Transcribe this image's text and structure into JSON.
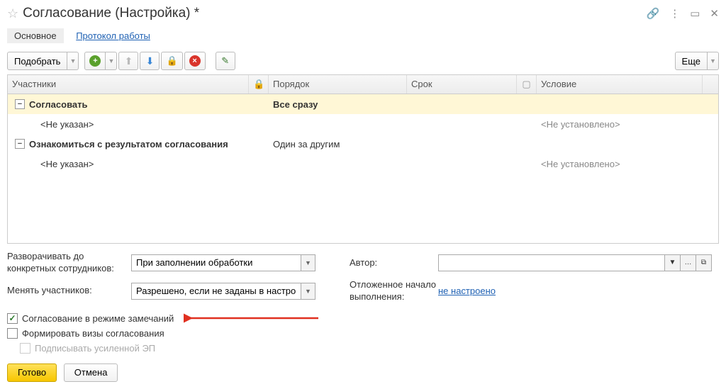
{
  "titlebar": {
    "title": "Согласование (Настройка) *"
  },
  "tabs": {
    "main": "Основное",
    "protocol": "Протокол работы"
  },
  "toolbar": {
    "pick_label": "Подобрать",
    "more_label": "Еще"
  },
  "table": {
    "headers": {
      "participants": "Участники",
      "order": "Порядок",
      "term": "Срок",
      "cond": "Условие"
    },
    "rows": [
      {
        "type": "group",
        "label": "Согласовать",
        "order": "Все сразу"
      },
      {
        "type": "child",
        "label": "<Не указан>",
        "cond": "<Не установлено>"
      },
      {
        "type": "group2",
        "label": "Ознакомиться с результатом согласования",
        "order": "Один за другим"
      },
      {
        "type": "child",
        "label": "<Не указан>",
        "cond": "<Не установлено>"
      }
    ]
  },
  "form": {
    "expand_to_label": "Разворачивать до конкретных сотрудников:",
    "expand_to_value": "При заполнении обработки",
    "change_participants_label": "Менять участников:",
    "change_participants_value": "Разрешено, если не заданы в настройках",
    "author_label": "Автор:",
    "deferred_label": "Отложенное начало выполнения:",
    "deferred_link": "не настроено"
  },
  "checks": {
    "remarks_mode": "Согласование в режиме замечаний",
    "form_visas": "Формировать визы согласования",
    "sign_ep": "Подписывать усиленной ЭП"
  },
  "footer": {
    "done": "Готово",
    "cancel": "Отмена"
  }
}
